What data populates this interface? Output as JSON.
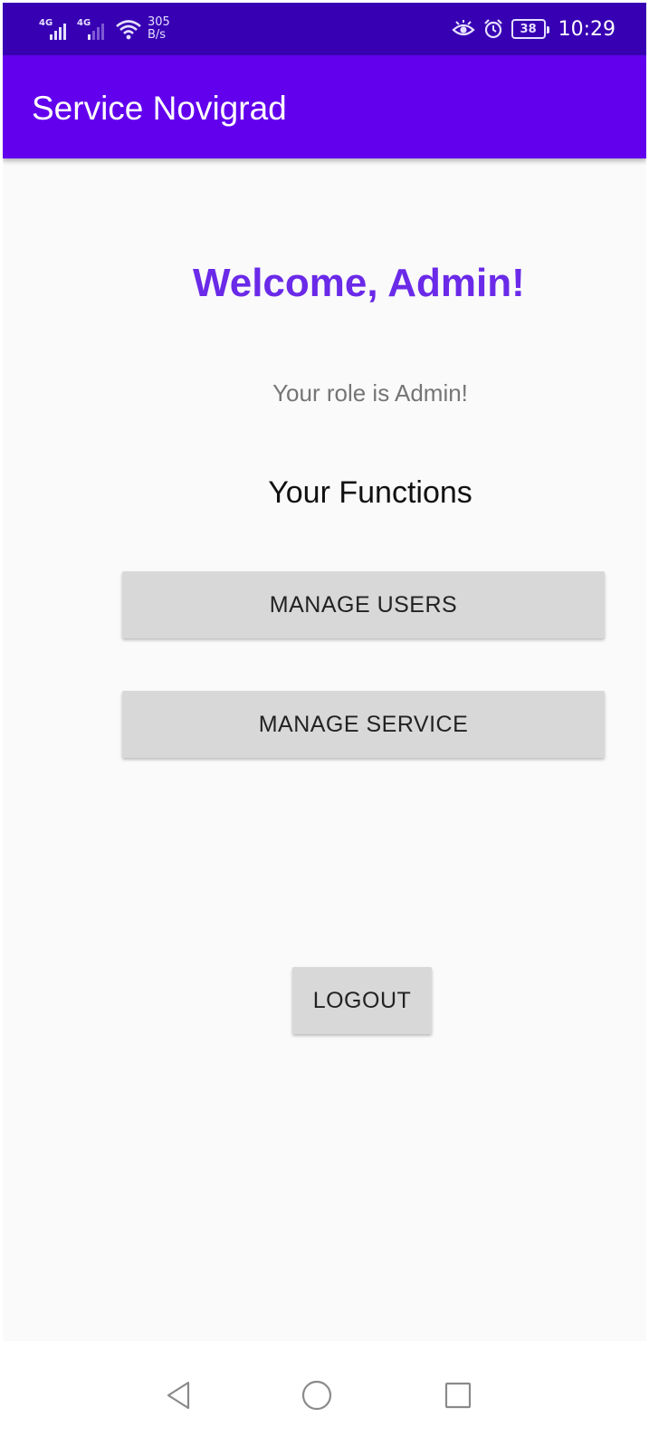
{
  "status_bar": {
    "sim1_tag": "4G",
    "sim2_tag": "4G",
    "net_speed_value": "305",
    "net_speed_unit": "B/s",
    "battery_level": "38",
    "time": "10:29"
  },
  "app_bar": {
    "title": "Service Novigrad"
  },
  "main": {
    "welcome_text": "Welcome, Admin!",
    "role_text": "Your role is Admin!",
    "functions_heading": "Your Functions",
    "manage_users_label": "MANAGE USERS",
    "manage_service_label": "MANAGE SERVICE",
    "logout_label": "LOGOUT"
  },
  "nav_bar": {
    "icons": [
      "back-icon",
      "home-icon",
      "recent-apps-icon"
    ]
  },
  "colors": {
    "status_bar": "#3700b3",
    "app_bar": "#6200ee",
    "welcome_text": "#6a2ae8",
    "button_bg": "#d7d8d7",
    "background": "#fafafa"
  }
}
